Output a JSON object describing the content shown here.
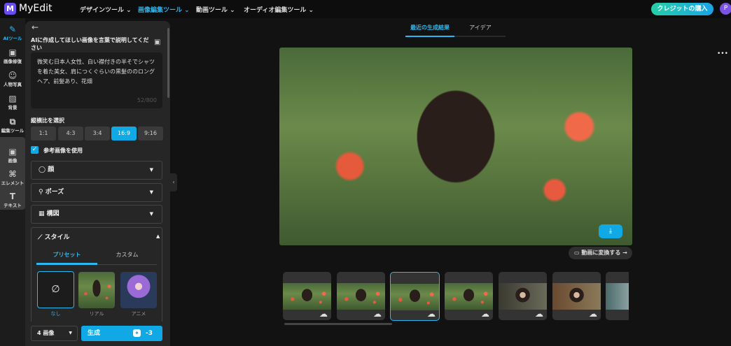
{
  "header": {
    "logo": "M",
    "brand": "MyEdit",
    "nav": [
      "デザインツール ⌄",
      "画像編集ツール ⌄",
      "動画ツール ⌄",
      "オーディオ編集ツール ⌄"
    ],
    "credit_button": "クレジットの購入",
    "avatar": "P"
  },
  "rail": [
    {
      "label": "AIツール",
      "icon": "✎"
    },
    {
      "label": "画像修復",
      "icon": "▣"
    },
    {
      "label": "人物写真",
      "icon": "☺"
    },
    {
      "label": "背景",
      "icon": "▨"
    },
    {
      "label": "編集ツール",
      "icon": "⧉"
    },
    {
      "label": "画像",
      "icon": "▣"
    },
    {
      "label": "エレメント",
      "icon": "⌘"
    },
    {
      "label": "テキスト",
      "icon": "T"
    }
  ],
  "panel": {
    "title": "AIに作成してほしい画像を言葉で説明してください",
    "prompt": "微笑む日本人女性、白い襟付きの半そでシャツを着た美女、肩につくぐらいの黒髪ののロングヘア、前髪あり、花畑",
    "counter": "52/800",
    "ratio_label": "縦横比を選択",
    "ratios": [
      "1:1",
      "4:3",
      "3:4",
      "16:9",
      "9:16"
    ],
    "selected_ratio": "16:9",
    "ref_checkbox": "参考画像を使用",
    "ref_checked": true,
    "accordions": [
      "顔",
      "ポーズ",
      "構図"
    ],
    "style": {
      "title": "スタイル",
      "tabs": [
        "プリセット",
        "カスタム"
      ],
      "presets": [
        "なし",
        "リアル",
        "アニメ"
      ]
    },
    "count_select": "4 画像",
    "generate": "生成",
    "cost": "-3"
  },
  "main": {
    "tabs": [
      "最近の生成結果",
      "アイデア"
    ],
    "convert_button": "動画に変換する →",
    "more": "•••"
  },
  "colors": {
    "accent": "#2cb8f0"
  }
}
